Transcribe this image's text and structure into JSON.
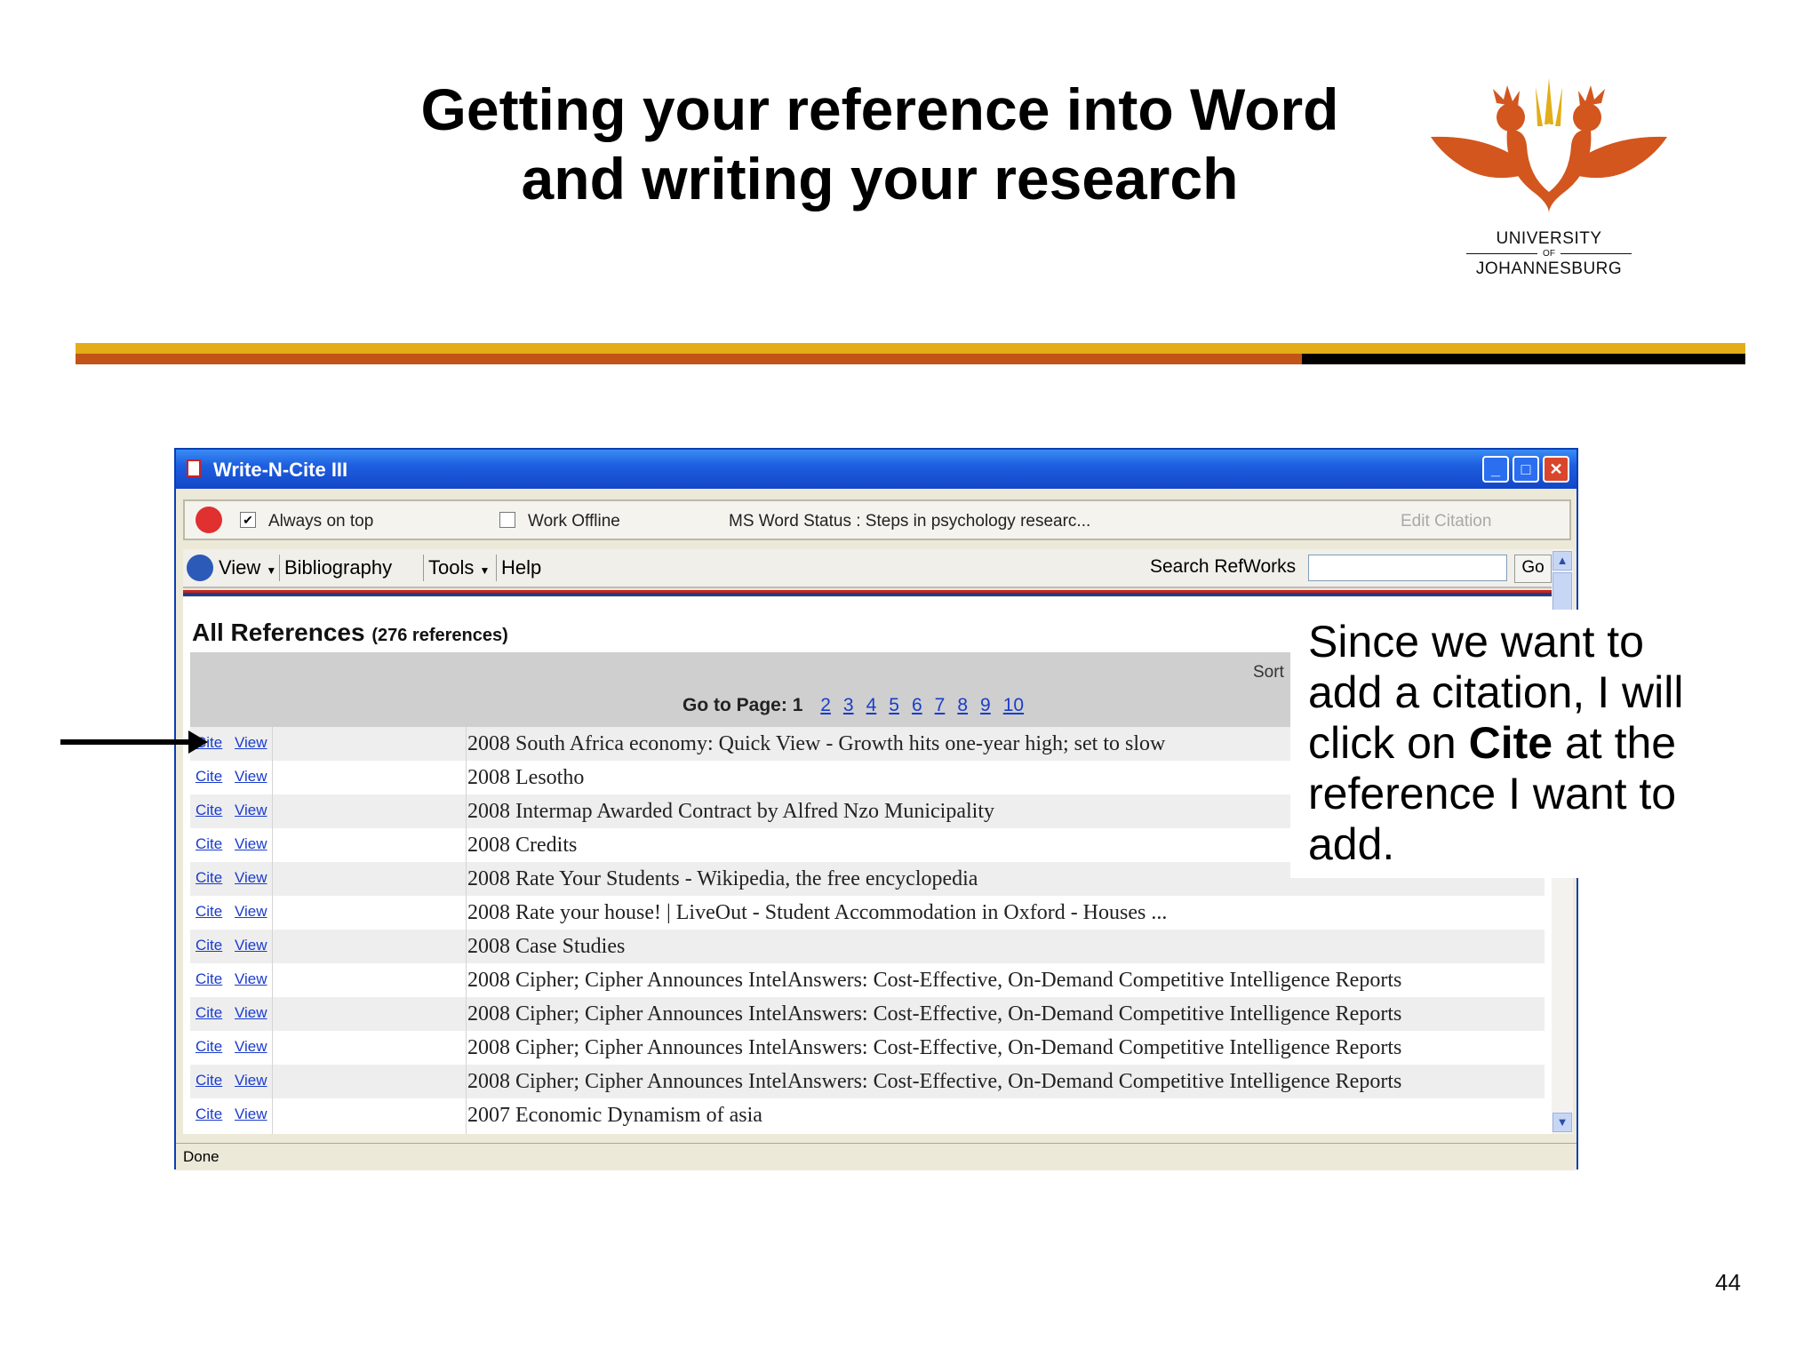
{
  "slide": {
    "title": "Getting your reference into Word and writing your research",
    "callout": "Since we want to add a citation, I will click on Cite at the reference I want to add.",
    "page_number": "44"
  },
  "logo": {
    "line1": "UNIVERSITY",
    "line2": "OF",
    "line3": "JOHANNESBURG",
    "brand_color": "#d2561e"
  },
  "stripes": {
    "gold": "#e2ad18",
    "orange": "#c25418",
    "black": "#000000"
  },
  "window": {
    "title": "Write-N-Cite III",
    "controls": {
      "minimize": "_",
      "maximize": "□",
      "close": "✕"
    },
    "options": {
      "always_on_top": "Always on top",
      "always_on_top_checked": true,
      "work_offline": "Work Offline",
      "work_offline_checked": false,
      "ms_word_status": "MS Word Status : Steps in psychology researc...",
      "edit_citation": "Edit Citation"
    },
    "menu": {
      "view": "View",
      "bibliography": "Bibliography",
      "tools": "Tools",
      "help": "Help",
      "search_label": "Search RefWorks",
      "search_value": "",
      "go": "Go"
    },
    "list": {
      "heading": "All References",
      "count": "(276 references)",
      "sort": "Sort",
      "goto_label": "Go to Page:",
      "current_page": "1",
      "pages": [
        "2",
        "3",
        "4",
        "5",
        "6",
        "7",
        "8",
        "9",
        "10"
      ],
      "cite": "Cite",
      "view": "View",
      "references": [
        "2008 South Africa economy: Quick View - Growth hits one-year high; set to slow",
        "2008 Lesotho",
        "2008 Intermap Awarded Contract by Alfred Nzo Municipality",
        "2008 Credits",
        "2008 Rate Your Students - Wikipedia, the free encyclopedia",
        "2008 Rate your house! | LiveOut - Student Accommodation in Oxford - Houses ...",
        "2008 Case Studies",
        "2008 Cipher; Cipher Announces IntelAnswers: Cost-Effective, On-Demand Competitive Intelligence Reports",
        "2008 Cipher; Cipher Announces IntelAnswers: Cost-Effective, On-Demand Competitive Intelligence Reports",
        "2008 Cipher; Cipher Announces IntelAnswers: Cost-Effective, On-Demand Competitive Intelligence Reports",
        "2008 Cipher; Cipher Announces IntelAnswers: Cost-Effective, On-Demand Competitive Intelligence Reports",
        "2007 Economic Dynamism of asia"
      ]
    },
    "status": "Done"
  }
}
